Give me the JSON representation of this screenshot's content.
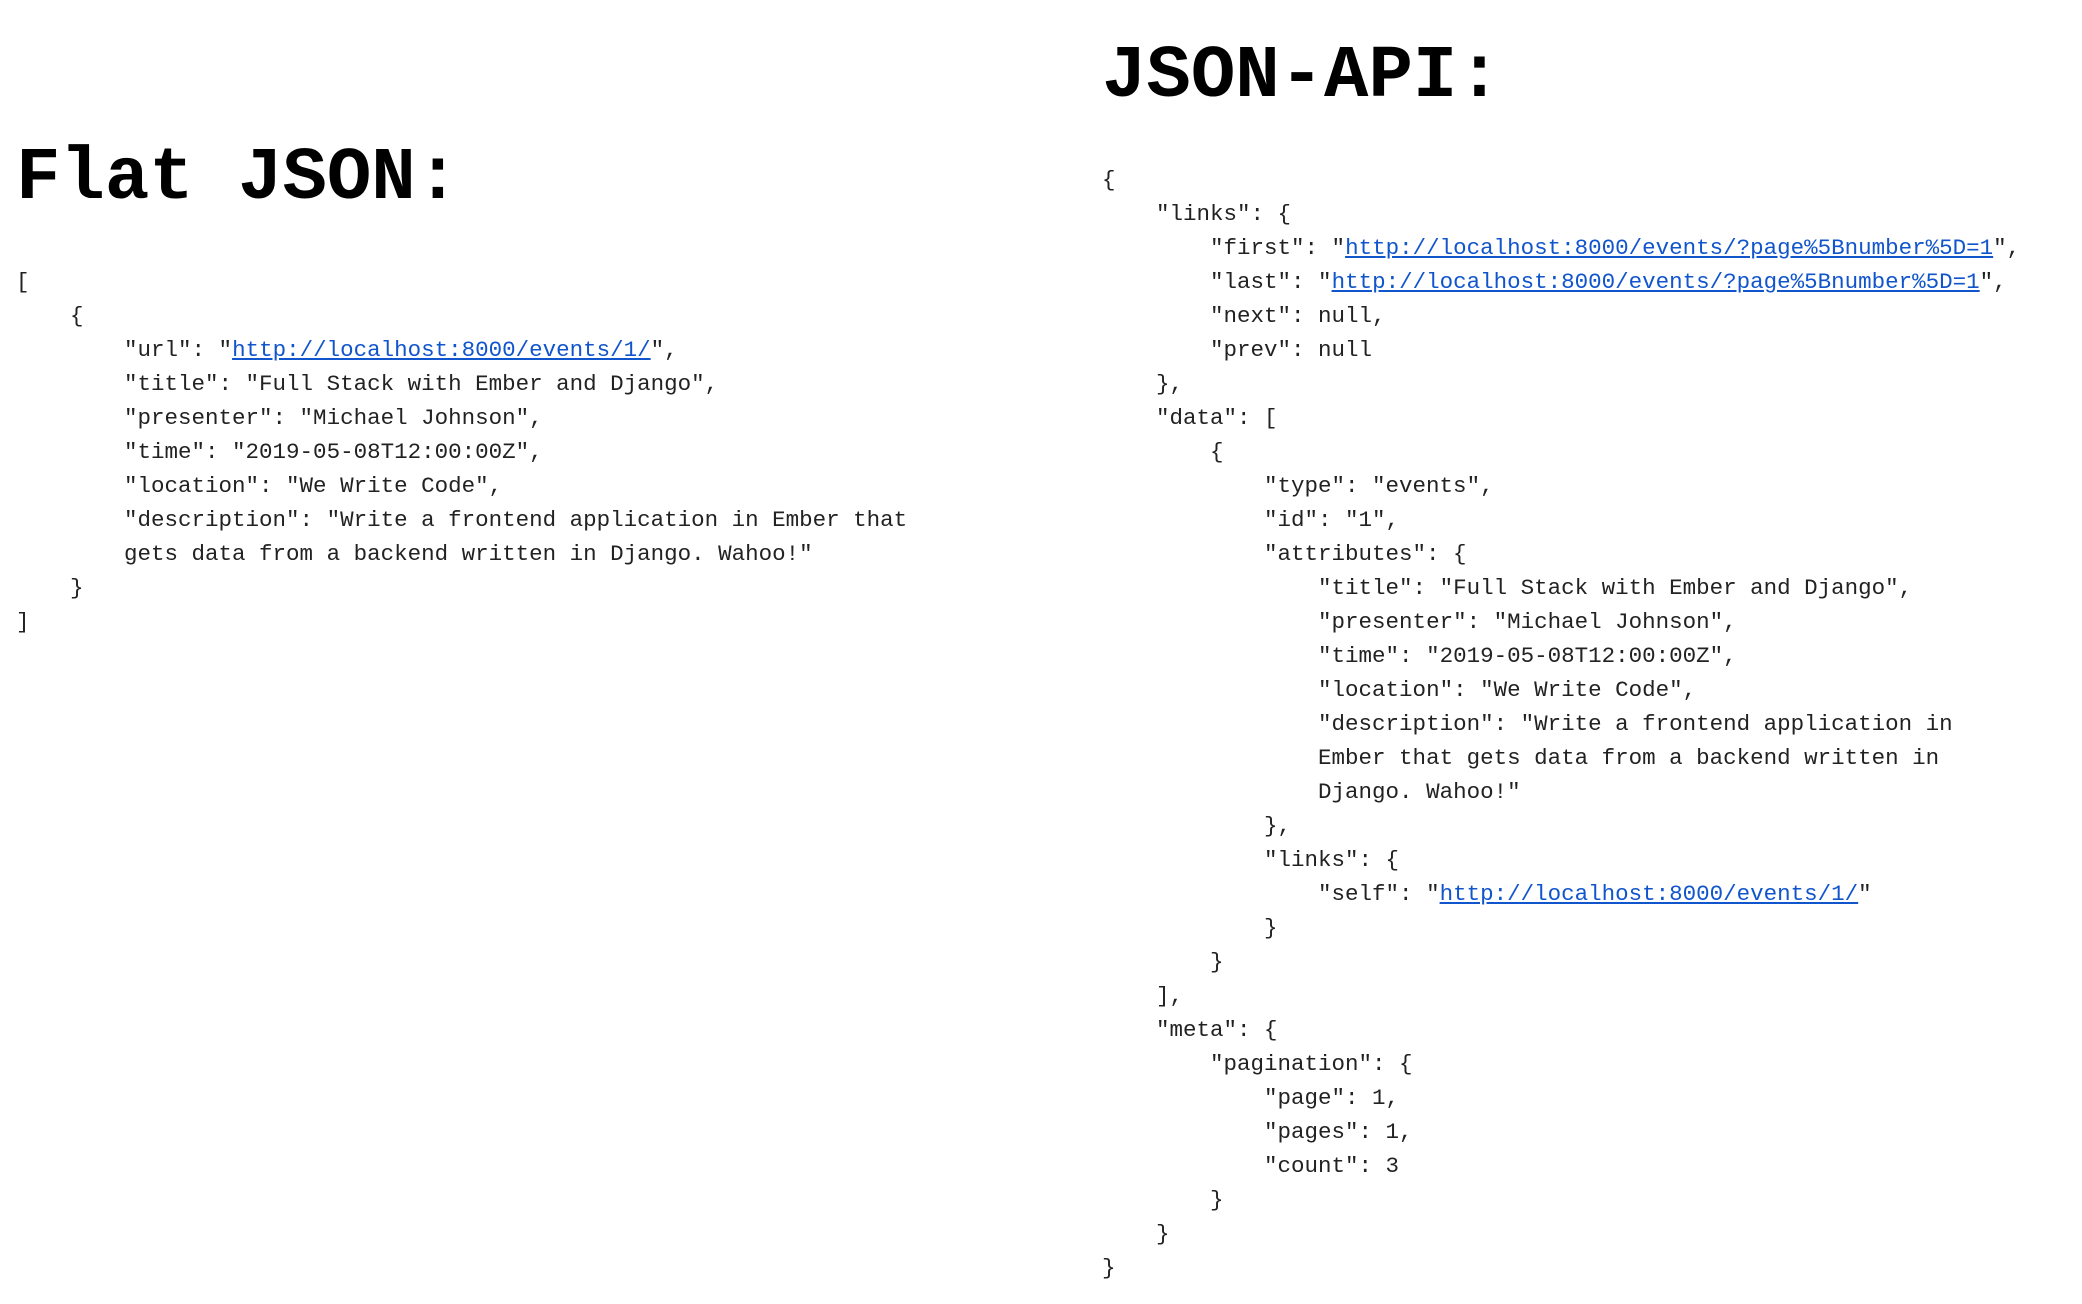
{
  "flat_panel": {
    "heading": "Flat JSON:",
    "lines": [
      {
        "indent": 0,
        "parts": [
          {
            "text": "["
          }
        ]
      },
      {
        "indent": 4,
        "parts": [
          {
            "text": "{"
          }
        ]
      },
      {
        "indent": 8,
        "parts": [
          {
            "text": "\"url\": \""
          },
          {
            "text": "http://localhost:8000/events/1/",
            "link": true
          },
          {
            "text": "\","
          }
        ]
      },
      {
        "indent": 8,
        "parts": [
          {
            "text": "\"title\": \"Full Stack with Ember and Django\","
          }
        ]
      },
      {
        "indent": 8,
        "parts": [
          {
            "text": "\"presenter\": \"Michael Johnson\","
          }
        ]
      },
      {
        "indent": 8,
        "parts": [
          {
            "text": "\"time\": \"2019-05-08T12:00:00Z\","
          }
        ]
      },
      {
        "indent": 8,
        "parts": [
          {
            "text": "\"location\": \"We Write Code\","
          }
        ]
      },
      {
        "indent": 8,
        "parts": [
          {
            "text": "\"description\": \"Write a frontend application in Ember that"
          }
        ]
      },
      {
        "indent": 8,
        "parts": [
          {
            "text": "gets data from a backend written in Django. Wahoo!\""
          }
        ]
      },
      {
        "indent": 4,
        "parts": [
          {
            "text": "}"
          }
        ]
      },
      {
        "indent": 0,
        "parts": [
          {
            "text": "]"
          }
        ]
      }
    ]
  },
  "api_panel": {
    "heading": "JSON-API:",
    "lines": [
      {
        "indent": 0,
        "parts": [
          {
            "text": "{"
          }
        ]
      },
      {
        "indent": 4,
        "parts": [
          {
            "text": "\"links\": {"
          }
        ]
      },
      {
        "indent": 8,
        "parts": [
          {
            "text": "\"first\": \""
          },
          {
            "text": "http://localhost:8000/events/?page%5Bnumber%5D=1",
            "link": true
          },
          {
            "text": "\","
          }
        ]
      },
      {
        "indent": 8,
        "parts": [
          {
            "text": "\"last\": \""
          },
          {
            "text": "http://localhost:8000/events/?page%5Bnumber%5D=1",
            "link": true
          },
          {
            "text": "\","
          }
        ]
      },
      {
        "indent": 8,
        "parts": [
          {
            "text": "\"next\": null,"
          }
        ]
      },
      {
        "indent": 8,
        "parts": [
          {
            "text": "\"prev\": null"
          }
        ]
      },
      {
        "indent": 4,
        "parts": [
          {
            "text": "},"
          }
        ]
      },
      {
        "indent": 4,
        "parts": [
          {
            "text": "\"data\": ["
          }
        ]
      },
      {
        "indent": 8,
        "parts": [
          {
            "text": "{"
          }
        ]
      },
      {
        "indent": 12,
        "parts": [
          {
            "text": "\"type\": \"events\","
          }
        ]
      },
      {
        "indent": 12,
        "parts": [
          {
            "text": "\"id\": \"1\","
          }
        ]
      },
      {
        "indent": 12,
        "parts": [
          {
            "text": "\"attributes\": {"
          }
        ]
      },
      {
        "indent": 16,
        "parts": [
          {
            "text": "\"title\": \"Full Stack with Ember and Django\","
          }
        ]
      },
      {
        "indent": 16,
        "parts": [
          {
            "text": "\"presenter\": \"Michael Johnson\","
          }
        ]
      },
      {
        "indent": 16,
        "parts": [
          {
            "text": "\"time\": \"2019-05-08T12:00:00Z\","
          }
        ]
      },
      {
        "indent": 16,
        "parts": [
          {
            "text": "\"location\": \"We Write Code\","
          }
        ]
      },
      {
        "indent": 16,
        "parts": [
          {
            "text": "\"description\": \"Write a frontend application in"
          }
        ]
      },
      {
        "indent": 16,
        "parts": [
          {
            "text": "Ember that gets data from a backend written in"
          }
        ]
      },
      {
        "indent": 16,
        "parts": [
          {
            "text": "Django. Wahoo!\""
          }
        ]
      },
      {
        "indent": 12,
        "parts": [
          {
            "text": "},"
          }
        ]
      },
      {
        "indent": 12,
        "parts": [
          {
            "text": "\"links\": {"
          }
        ]
      },
      {
        "indent": 16,
        "parts": [
          {
            "text": "\"self\": \""
          },
          {
            "text": "http://localhost:8000/events/1/",
            "link": true
          },
          {
            "text": "\""
          }
        ]
      },
      {
        "indent": 12,
        "parts": [
          {
            "text": "}"
          }
        ]
      },
      {
        "indent": 8,
        "parts": [
          {
            "text": "}"
          }
        ]
      },
      {
        "indent": 4,
        "parts": [
          {
            "text": "],"
          }
        ]
      },
      {
        "indent": 4,
        "parts": [
          {
            "text": "\"meta\": {"
          }
        ]
      },
      {
        "indent": 8,
        "parts": [
          {
            "text": "\"pagination\": {"
          }
        ]
      },
      {
        "indent": 12,
        "parts": [
          {
            "text": "\"page\": 1,"
          }
        ]
      },
      {
        "indent": 12,
        "parts": [
          {
            "text": "\"pages\": 1,"
          }
        ]
      },
      {
        "indent": 12,
        "parts": [
          {
            "text": "\"count\": 3"
          }
        ]
      },
      {
        "indent": 8,
        "parts": [
          {
            "text": "}"
          }
        ]
      },
      {
        "indent": 4,
        "parts": [
          {
            "text": "}"
          }
        ]
      },
      {
        "indent": 0,
        "parts": [
          {
            "text": "}"
          }
        ]
      }
    ]
  }
}
